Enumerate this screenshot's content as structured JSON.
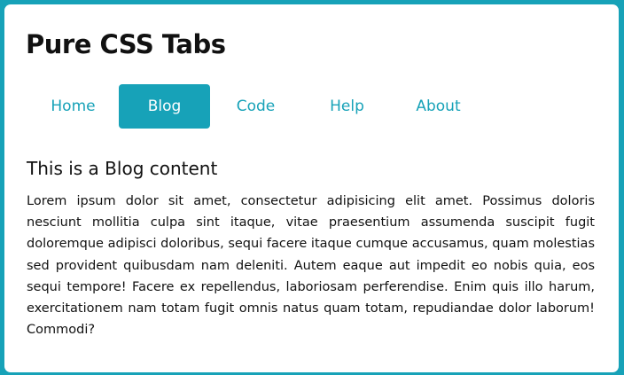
{
  "header": {
    "title": "Pure CSS Tabs"
  },
  "tabs": [
    {
      "label": "Home",
      "active": false
    },
    {
      "label": "Blog",
      "active": true
    },
    {
      "label": "Code",
      "active": false
    },
    {
      "label": "Help",
      "active": false
    },
    {
      "label": "About",
      "active": false
    }
  ],
  "content": {
    "title": "This is a Blog content",
    "body": "Lorem ipsum dolor sit amet, consectetur adipisicing elit amet. Possimus doloris nesciunt mollitia culpa sint itaque, vitae praesentium assumenda suscipit fugit doloremque adipisci doloribus, sequi facere itaque cumque accusamus, quam molestias sed provident quibusdam nam deleniti. Autem eaque aut impedit eo nobis quia, eos sequi tempore! Facere ex repellendus, laboriosam perferendise. Enim quis illo harum, exercitationem nam totam fugit omnis natus quam totam, repudiandae dolor laborum! Commodi?"
  },
  "colors": {
    "accent": "#17a2b8",
    "background": "#17a2b8",
    "card": "#ffffff",
    "text": "#111111"
  }
}
